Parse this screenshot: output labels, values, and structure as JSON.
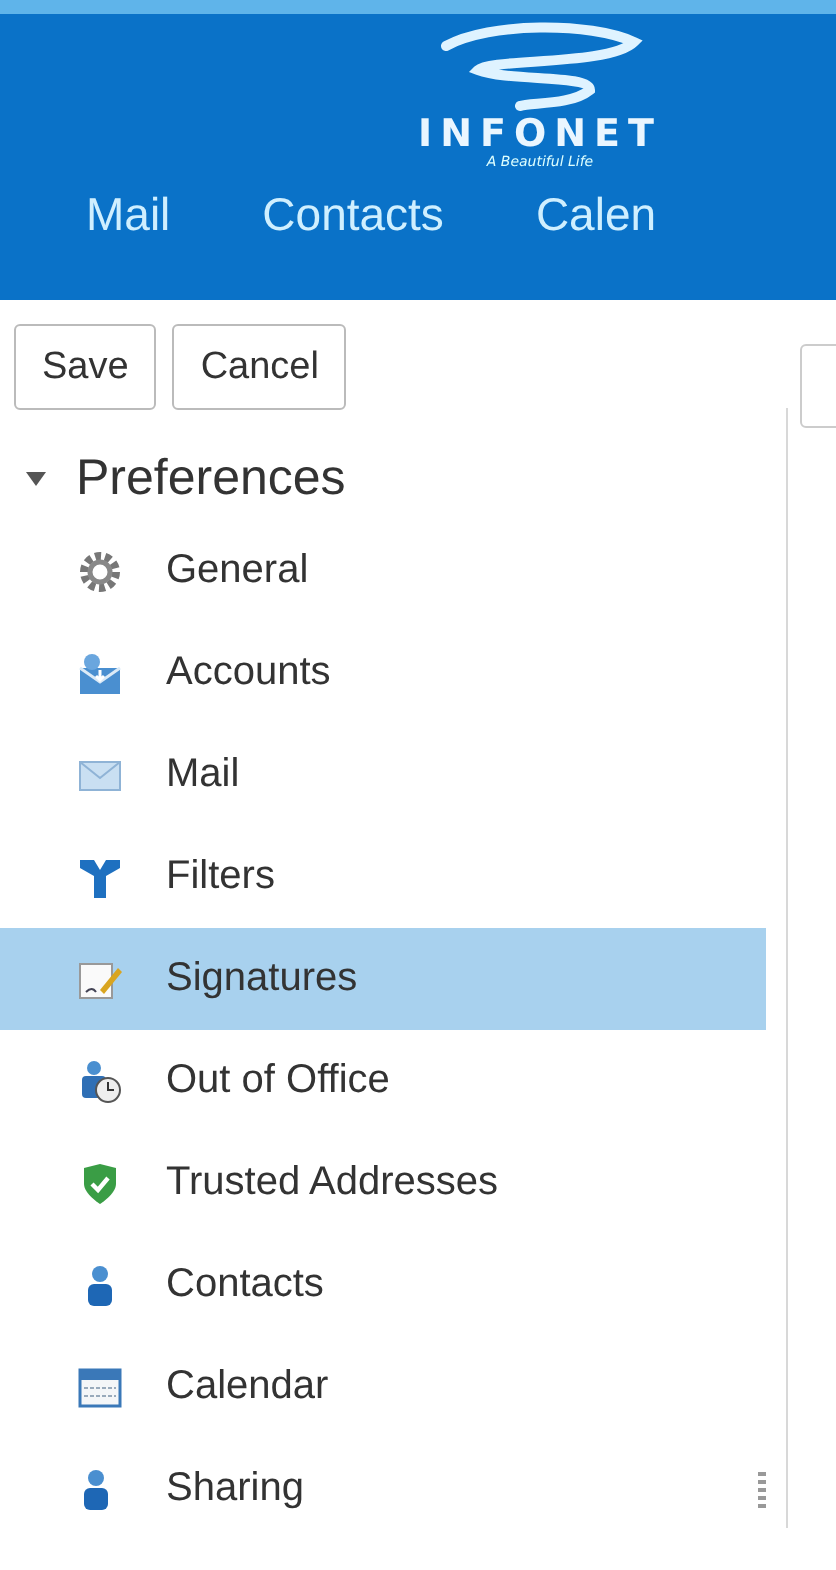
{
  "header": {
    "logo": {
      "name": "INFONET",
      "tagline": "A Beautiful Life"
    },
    "nav": [
      {
        "label": "Mail",
        "selected": false
      },
      {
        "label": "Contacts",
        "selected": false
      },
      {
        "label": "Calen",
        "selected": false
      }
    ]
  },
  "toolbar": {
    "buttons": [
      "Save",
      "Cancel"
    ]
  },
  "sidebar": {
    "title": "Preferences",
    "expanded": true,
    "items": [
      {
        "label": "General",
        "kind": "gear",
        "selected": false
      },
      {
        "label": "Accounts",
        "kind": "accounts",
        "selected": false
      },
      {
        "label": "Mail",
        "kind": "mail",
        "selected": false
      },
      {
        "label": "Filters",
        "kind": "filter",
        "selected": false
      },
      {
        "label": "Signatures",
        "kind": "signature",
        "selected": true
      },
      {
        "label": "Out of Office",
        "kind": "outofoffice",
        "selected": false
      },
      {
        "label": "Trusted Addresses",
        "kind": "shield",
        "selected": false
      },
      {
        "label": "Contacts",
        "kind": "contact",
        "selected": false
      },
      {
        "label": "Calendar",
        "kind": "calendar",
        "selected": false
      },
      {
        "label": "Sharing",
        "kind": "sharing",
        "selected": false
      }
    ]
  }
}
